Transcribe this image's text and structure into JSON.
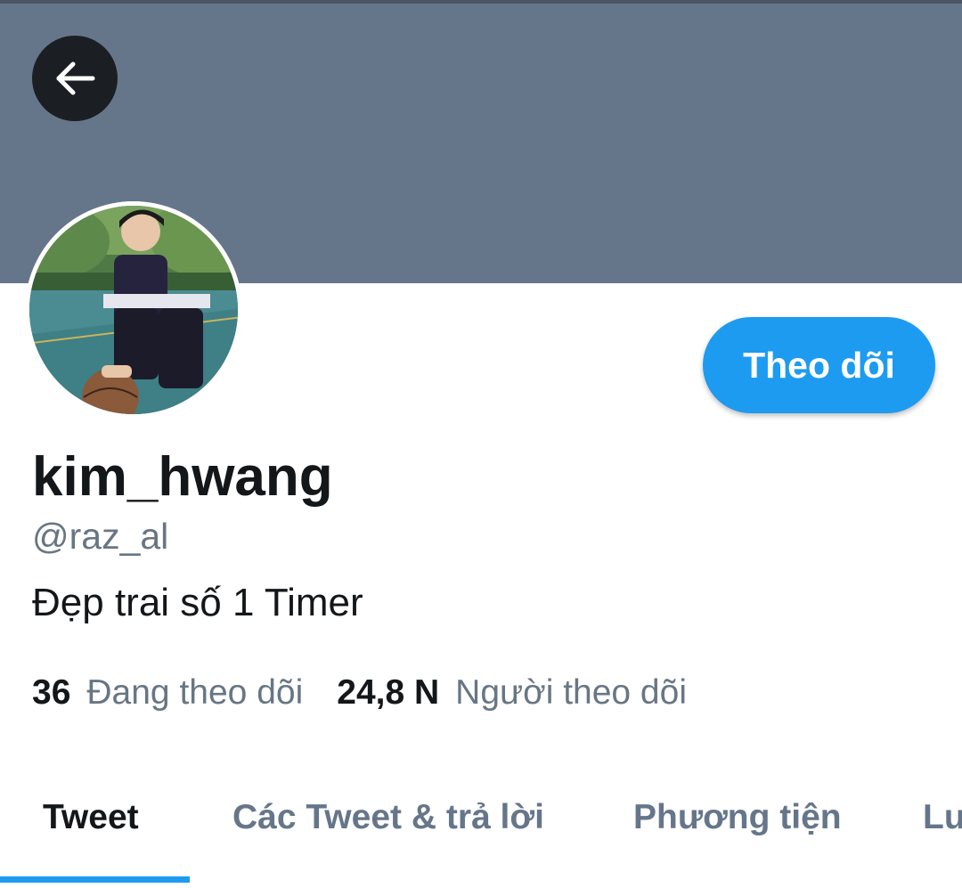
{
  "header": {
    "back_icon": "arrow-left-icon",
    "banner_color": "#66768a"
  },
  "profile": {
    "avatar_icon": "profile-photo",
    "display_name": "kim_hwang",
    "handle": "@raz_al",
    "bio": "Đẹp trai số 1 Timer",
    "follow_button_label": "Theo dõi",
    "accent_color": "#1d9bf0"
  },
  "stats": {
    "following_count": "36",
    "following_label": "Đang theo dõi",
    "followers_count": "24,8 N",
    "followers_label": "Người theo dõi"
  },
  "tabs": [
    {
      "label": "Tweet",
      "active": true
    },
    {
      "label": "Các Tweet & trả lời",
      "active": false
    },
    {
      "label": "Phương tiện",
      "active": false
    },
    {
      "label": "Lượt thích",
      "active": false
    }
  ]
}
